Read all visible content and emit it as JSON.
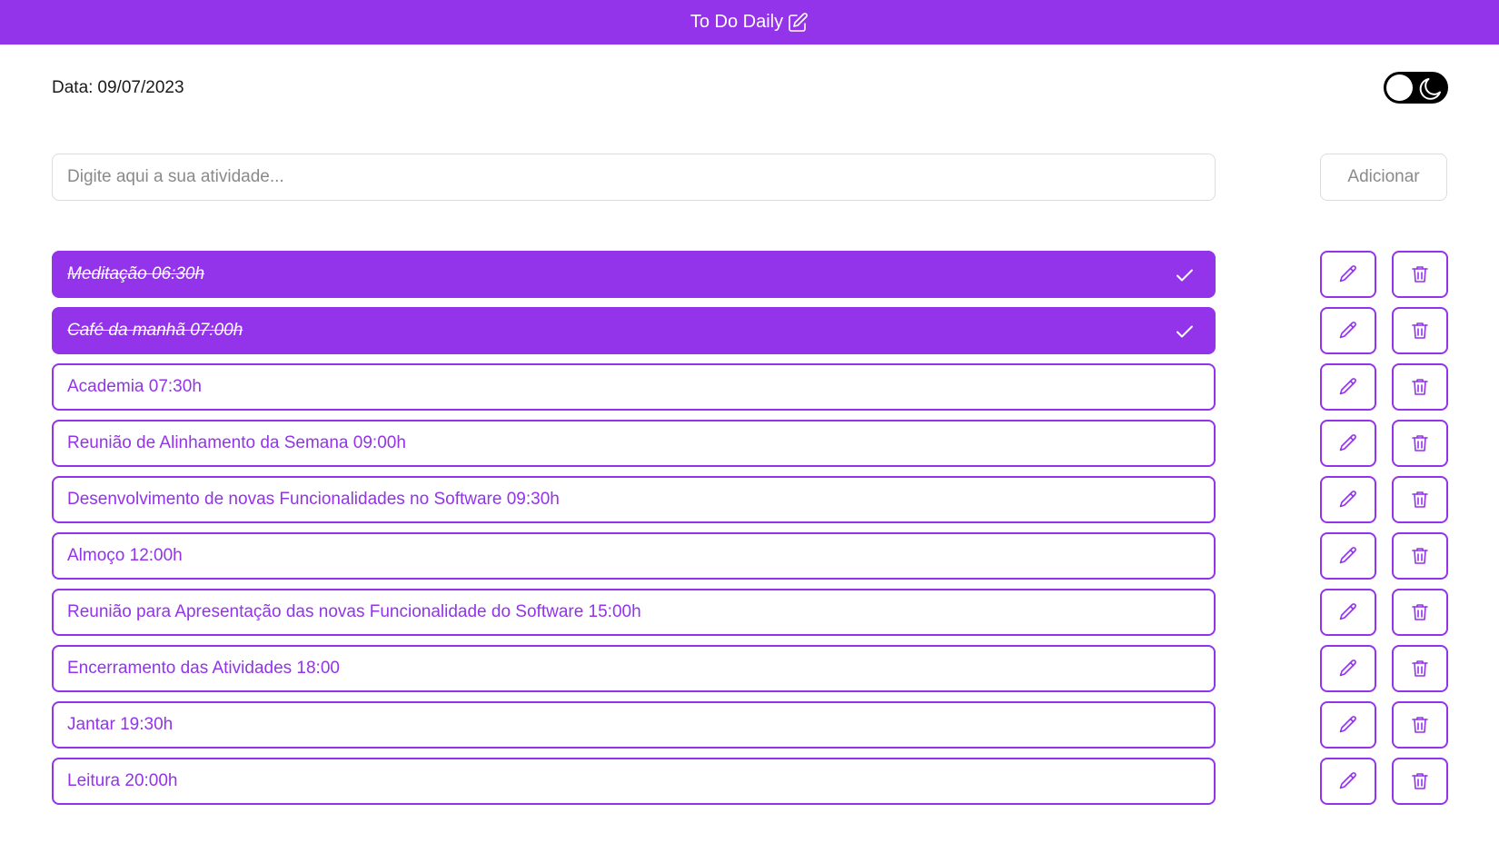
{
  "header": {
    "title": "To Do Daily",
    "title_icon": "pencil-square-icon",
    "background": "#9333ea"
  },
  "date": {
    "label": "Data:",
    "value": "09/07/2023"
  },
  "theme_toggle": {
    "mode": "dark",
    "icon": "moon-icon"
  },
  "new_task": {
    "placeholder": "Digite aqui a sua atividade...",
    "add_label": "Adicionar"
  },
  "colors": {
    "accent": "#9333ea",
    "border_light": "#dcdcdc"
  },
  "tasks": [
    {
      "text": "Meditação 06:30h",
      "done": true
    },
    {
      "text": "Café da manhã 07:00h",
      "done": true
    },
    {
      "text": "Academia 07:30h",
      "done": false
    },
    {
      "text": "Reunião de Alinhamento da Semana 09:00h",
      "done": false
    },
    {
      "text": "Desenvolvimento de novas Funcionalidades no Software 09:30h",
      "done": false
    },
    {
      "text": "Almoço 12:00h",
      "done": false
    },
    {
      "text": "Reunião para Apresentação das novas Funcionalidade do Software 15:00h",
      "done": false
    },
    {
      "text": "Encerramento das Atividades 18:00",
      "done": false
    },
    {
      "text": "Jantar 19:30h",
      "done": false
    },
    {
      "text": "Leitura 20:00h",
      "done": false
    }
  ]
}
